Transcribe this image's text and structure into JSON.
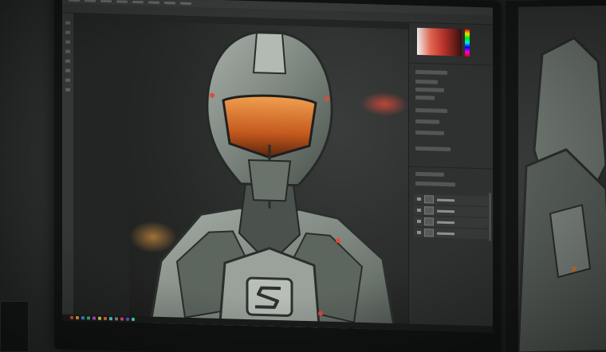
{
  "scene": {
    "main_app": "photo-editor",
    "artwork_subject_icon": "armored-robot-illustration",
    "chest_emblem_icon": "s-logo-emblem"
  },
  "colors": {
    "visor_orange": "#e07a2c",
    "armor_gray": "#8e968f",
    "armor_dark": "#3b403c",
    "accent_red": "#e04a3a",
    "ui_panel": "#2f3130",
    "ui_bg": "#232524"
  },
  "taskbar_icon_colors": [
    "#d84b3b",
    "#e0a13a",
    "#4a8be0",
    "#3ac06a",
    "#c04ad8",
    "#d8d84a",
    "#e06a3a",
    "#4ad8d8",
    "#8a8a8a",
    "#e04a6a",
    "#6a4ae0",
    "#3ae0a0"
  ]
}
